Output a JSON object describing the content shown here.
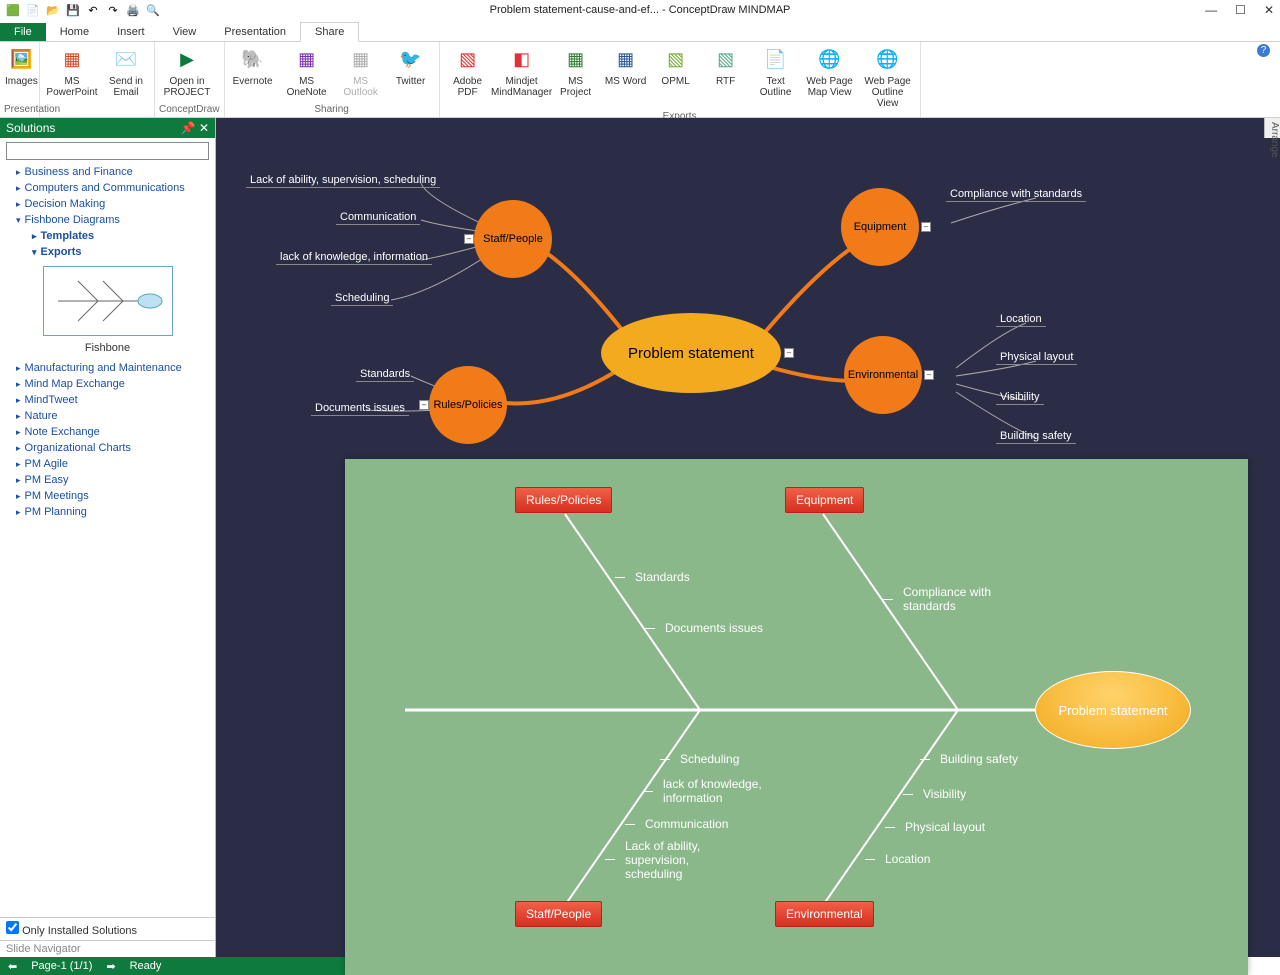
{
  "window": {
    "title": "Problem statement-cause-and-ef... - ConceptDraw MINDMAP"
  },
  "menu": {
    "file": "File",
    "home": "Home",
    "insert": "Insert",
    "view": "View",
    "presentation": "Presentation",
    "share": "Share"
  },
  "ribbon": {
    "presentation_label": "Presentation",
    "sharing_label": "Sharing",
    "exports_label": "Exports",
    "conceptdraw_label": "ConceptDraw",
    "buttons": {
      "images": "Images",
      "msppt": "MS PowerPoint",
      "email": "Send in Email",
      "openproj": "Open in PROJECT",
      "evernote": "Evernote",
      "msonenote": "MS OneNote",
      "msoutlook": "MS Outlook",
      "twitter": "Twitter",
      "adobe": "Adobe PDF",
      "mindjet": "Mindjet MindManager",
      "msproj": "MS Project",
      "msword": "MS Word",
      "opml": "OPML",
      "rtf": "RTF",
      "textout": "Text Outline",
      "wpmap": "Web Page Map View",
      "wpout": "Web Page Outline View"
    }
  },
  "side": {
    "title": "Solutions",
    "items": [
      "Business and Finance",
      "Computers and Communications",
      "Decision Making",
      "Fishbone Diagrams"
    ],
    "fishbone_children": [
      "Templates",
      "Exports"
    ],
    "thumb_label": "Fishbone",
    "rest": [
      "Manufacturing and Maintenance",
      "Mind Map Exchange",
      "MindTweet",
      "Nature",
      "Note Exchange",
      "Organizational Charts",
      "PM Agile",
      "PM Easy",
      "PM Meetings",
      "PM Planning"
    ],
    "only_installed": "Only Installed Solutions",
    "slide_nav": "Slide Navigator"
  },
  "status": {
    "page": "Page-1 (1/1)",
    "ready": "Ready"
  },
  "mindmap": {
    "center": "Problem statement",
    "nodes": {
      "staff": "Staff/People",
      "rules": "Rules/Policies",
      "equipment": "Equipment",
      "env": "Environmental"
    },
    "staff_leaves": [
      "Lack of ability, supervision, scheduling",
      "Communication",
      "lack of knowledge, information",
      "Scheduling"
    ],
    "rules_leaves": [
      "Standards",
      "Documents issues"
    ],
    "equip_leaves": [
      "Compliance with standards"
    ],
    "env_leaves": [
      "Location",
      "Physical layout",
      "Visibility",
      "Building safety"
    ]
  },
  "fishbone": {
    "head": "Problem statement",
    "cats": {
      "rules": "Rules/Policies",
      "equipment": "Equipment",
      "staff": "Staff/People",
      "env": "Environmental"
    },
    "rules_leaves": [
      "Standards",
      "Documents issues"
    ],
    "equip_leaves": [
      "Compliance with standards"
    ],
    "staff_leaves": [
      "Scheduling",
      "lack of knowledge, information",
      "Communication",
      "Lack of ability, supervision, scheduling"
    ],
    "env_leaves": [
      "Building safety",
      "Visibility",
      "Physical layout",
      "Location"
    ]
  },
  "arrange": "Arrange"
}
